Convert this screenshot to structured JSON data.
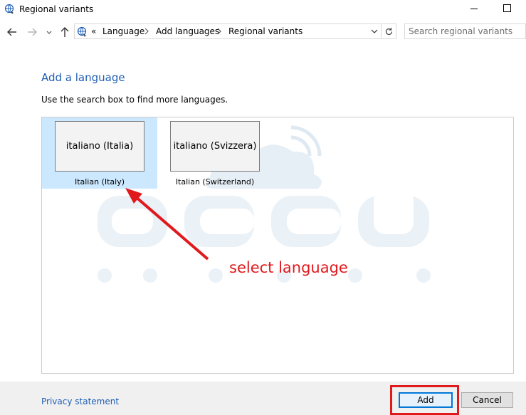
{
  "window": {
    "title": "Regional variants"
  },
  "nav": {
    "breadcrumb_overflow": "«",
    "breadcrumbs": [
      "Language",
      "Add languages",
      "Regional variants"
    ],
    "search_placeholder": "Search regional variants"
  },
  "content": {
    "heading": "Add a language",
    "description": "Use the search box to find more languages."
  },
  "languages": [
    {
      "native": "italiano (Italia)",
      "english": "Italian (Italy)",
      "selected": true
    },
    {
      "native": "italiano (Svizzera)",
      "english": "Italian (Switzerland)",
      "selected": false
    }
  ],
  "annotation": {
    "text": "select language",
    "color": "#e0191c"
  },
  "footer": {
    "privacy_link": "Privacy statement",
    "add_label": "Add",
    "cancel_label": "Cancel"
  },
  "colors": {
    "heading_blue": "#1e5eb5",
    "selection": "#cce8ff",
    "footer_bg": "#f0f0f0"
  }
}
